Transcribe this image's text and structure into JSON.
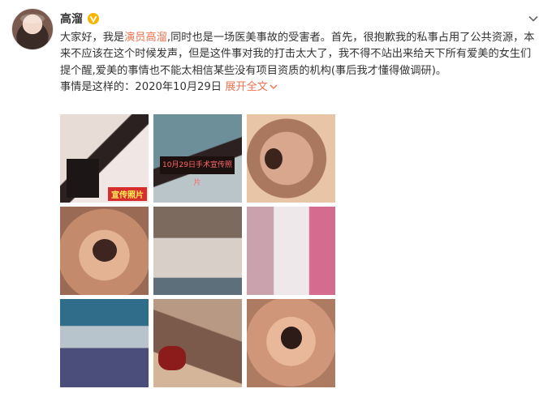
{
  "user": {
    "name": "高溜",
    "verified": true
  },
  "post": {
    "segments": [
      {
        "text": "大家好，我是",
        "type": "plain"
      },
      {
        "text": "演员高溜",
        "type": "mention"
      },
      {
        "text": ",同时也是一场医美事故的受害者。首先，很抱歉我的私事占用了公共资源，本来不应该在这个时候发声，但是这件事对我的打击太大了，我不得不站出来给天下所有爱美的女生们提个醒,爱美的事情也不能太相信某些没有项目资质的机构(事后我才懂得做调研)。",
        "type": "plain"
      },
      {
        "text": "事情是这样的：2020年10月29日",
        "type": "plain"
      }
    ],
    "expand_label": "展开全文"
  },
  "photos": [
    {
      "label": "photo-collage-profile",
      "badge": "宣传照片"
    },
    {
      "label": "photo-surgery-collage",
      "caption": "10月29日手术宣传照片"
    },
    {
      "label": "photo-nose-injury-1"
    },
    {
      "label": "photo-nose-injury-2"
    },
    {
      "label": "photo-selfie-bandage"
    },
    {
      "label": "photo-mirror-selfie"
    },
    {
      "label": "photo-clinic-selfie"
    },
    {
      "label": "photo-surgery-closeup"
    },
    {
      "label": "photo-nose-injury-3"
    }
  ],
  "colors": {
    "accent": "#eb7350",
    "verified_badge": "#f7b500",
    "text": "#333333"
  }
}
